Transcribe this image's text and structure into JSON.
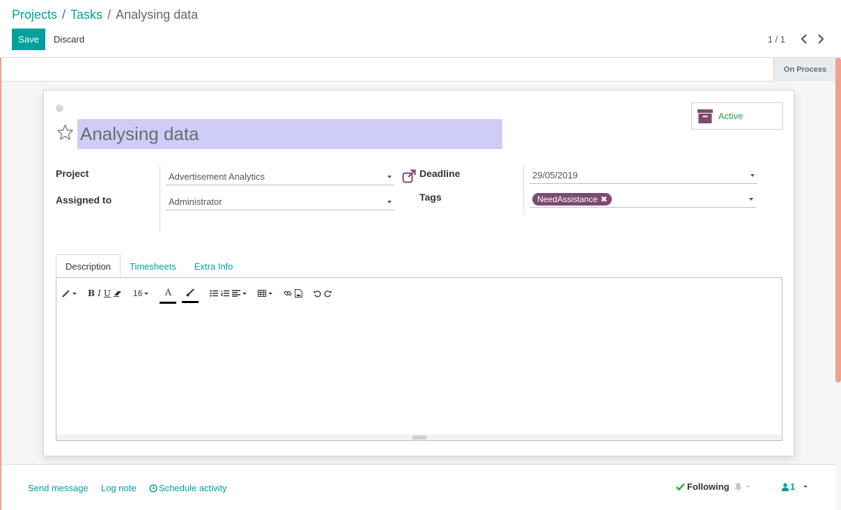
{
  "breadcrumb": {
    "projects": "Projects",
    "tasks": "Tasks",
    "current": "Analysing data"
  },
  "buttons": {
    "save": "Save",
    "discard": "Discard"
  },
  "pager": {
    "counter": "1 / 1"
  },
  "statusbar": {
    "stage": "On Process"
  },
  "task": {
    "title": "Analysing data",
    "active_label": "Active",
    "labels": {
      "project": "Project",
      "assigned_to": "Assigned to",
      "deadline": "Deadline",
      "tags": "Tags"
    },
    "project": "Advertisement Analytics",
    "assigned_to": "Administrator",
    "deadline": "29/05/2019",
    "tag": "NeedAssistance"
  },
  "tabs": {
    "description": "Description",
    "timesheets": "Timesheets",
    "extra_info": "Extra Info"
  },
  "editor": {
    "font_size": "16"
  },
  "chatter": {
    "send_message": "Send message",
    "log_note": "Log note",
    "schedule_activity": "Schedule activity",
    "following": "Following",
    "followers_count": "1"
  },
  "colors": {
    "primary": "#00A09D",
    "tag": "#7c4a6f",
    "active": "#28a745",
    "title_highlight": "#cfcdf7"
  }
}
